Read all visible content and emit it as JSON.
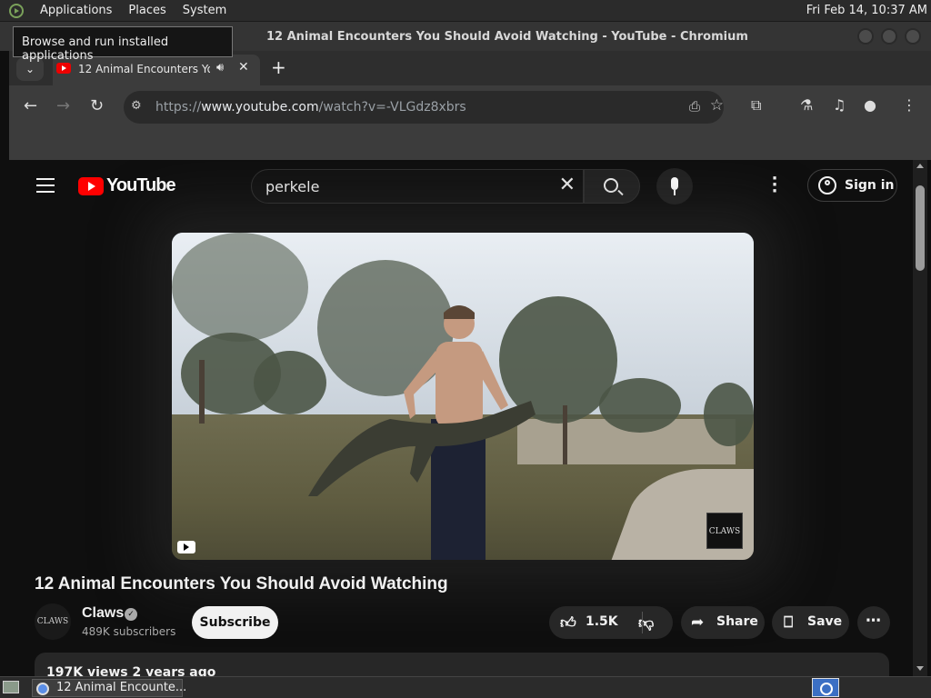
{
  "desktop_panel": {
    "menus": [
      "Applications",
      "Places",
      "System"
    ],
    "clock": "Fri Feb 14, 10:37 AM"
  },
  "tooltip": "Browse and run installed applications",
  "window": {
    "title": "12 Animal Encounters You Should Avoid Watching - YouTube - Chromium"
  },
  "tabs": {
    "active_label": "12 Animal Encounters You Should Avoid Watching - YouTube",
    "new_tab": "+"
  },
  "toolbar": {
    "url_prefix": "https://",
    "url_host": "www.youtube.com",
    "url_path": "/watch?v=-VLGdz8xbrs"
  },
  "youtube": {
    "logo_text": "YouTube",
    "search_value": "perkele",
    "sign_in": "Sign in",
    "video_title": "12 Animal Encounters You Should Avoid Watching",
    "channel_name": "Claws",
    "channel_avatar_text": "CLAWS",
    "subscribers": "489K subscribers",
    "subscribe_label": "Subscribe",
    "likes": "1.5K",
    "share_label": "Share",
    "save_label": "Save",
    "meta": "197K views  2 years ago",
    "watermark": "CLAWS",
    "colors": {
      "brand_red": "#ff0000",
      "background": "#0f0f0f"
    }
  },
  "taskbar": {
    "task_label": "12 Animal Encounte..."
  }
}
